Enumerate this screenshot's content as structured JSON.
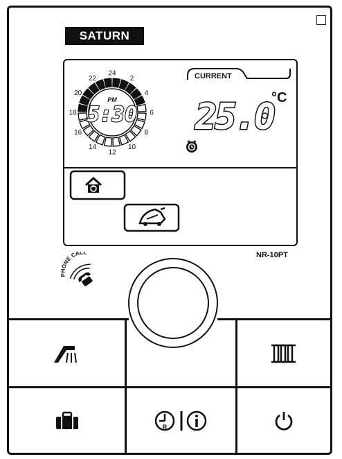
{
  "brand": {
    "name": "SATURN"
  },
  "display": {
    "clock": {
      "time": "5:30",
      "period": "PM",
      "hours": [
        "24",
        "2",
        "4",
        "6",
        "8",
        "10",
        "12",
        "14",
        "16",
        "18",
        "20",
        "22"
      ]
    },
    "current_label": "CURRENT",
    "temperature": "25.0",
    "unit": "°C"
  },
  "model": "NR-10PT",
  "phone_call_label": "PHONE CALL",
  "buttons": [
    {
      "name": "shower-button",
      "icon": "shower-icon"
    },
    {
      "name": "radiator-button",
      "icon": "radiator-icon"
    },
    {
      "name": "away-button",
      "icon": "suitcase-icon"
    },
    {
      "name": "reset-info-button",
      "icon": "clock-reset-info-icon"
    },
    {
      "name": "power-button",
      "icon": "power-icon"
    }
  ],
  "colors": {
    "ink": "#111111",
    "background": "#ffffff"
  }
}
